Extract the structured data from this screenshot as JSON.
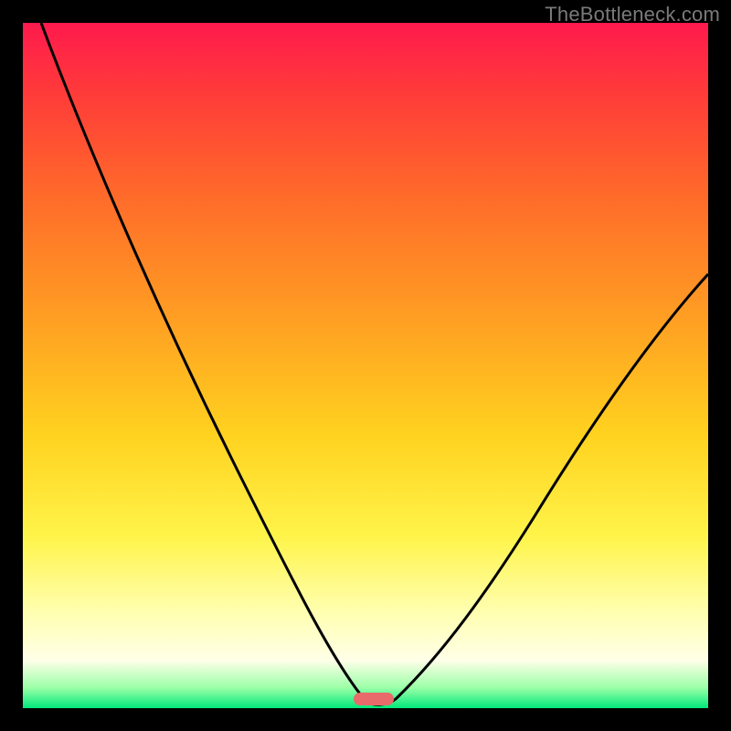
{
  "watermark": "TheBottleneck.com",
  "chart_data": {
    "type": "line",
    "title": "",
    "xlabel": "",
    "ylabel": "",
    "xlim": [
      0,
      100
    ],
    "ylim": [
      0,
      100
    ],
    "grid": false,
    "legend": false,
    "series": [
      {
        "name": "bottleneck-curve",
        "x": [
          0,
          10,
          20,
          30,
          40,
          48,
          52,
          56,
          60,
          70,
          80,
          90,
          100
        ],
        "y": [
          100,
          78,
          58,
          40,
          22,
          6,
          0,
          2,
          8,
          22,
          36,
          50,
          63
        ]
      }
    ],
    "optimal_point": {
      "x": 52,
      "y": 0
    }
  },
  "colors": {
    "background": "#000000",
    "marker": "#e96a6a",
    "gradient_top": "#ff1a4d",
    "gradient_bottom": "#00e87a"
  }
}
